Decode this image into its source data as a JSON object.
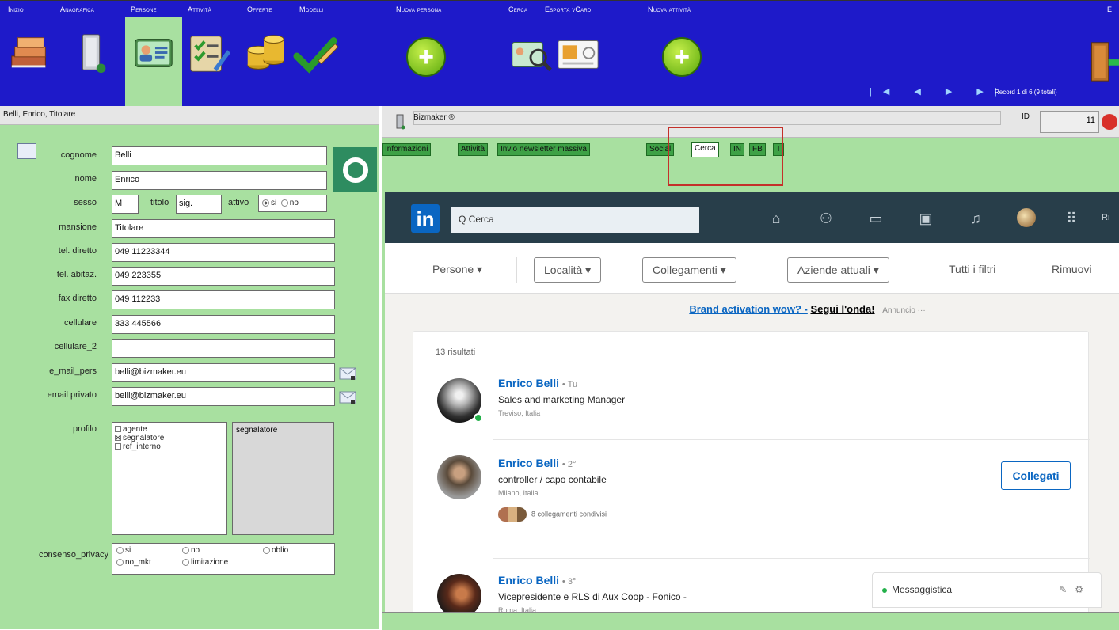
{
  "toolbar": {
    "menu": [
      {
        "label": "Inizio"
      },
      {
        "label": "Anagrafica"
      },
      {
        "label": "Persone"
      },
      {
        "label": "Attività"
      },
      {
        "label": "Offerte"
      },
      {
        "label": "Modelli"
      },
      {
        "label": "Nuova persona"
      },
      {
        "label": "Cerca"
      },
      {
        "label": "Esporta vCard"
      },
      {
        "label": "Nuova attività"
      },
      {
        "label": "E"
      }
    ],
    "plus_symbol": "+",
    "nav_arrows": "|◀ ◀ ▶ ▶|",
    "record_info": "Record 1 di 6 (9 totali)"
  },
  "left": {
    "header": "Belli, Enrico, Titolare",
    "fields": {
      "cognome": {
        "label": "cognome",
        "value": "Belli"
      },
      "nome": {
        "label": "nome",
        "value": "Enrico"
      },
      "sesso": {
        "label": "sesso",
        "value": "M"
      },
      "titolo": {
        "label": "titolo",
        "value": "sig."
      },
      "attivo": {
        "label": "attivo",
        "opt_si": "si",
        "opt_no": "no"
      },
      "mansione": {
        "label": "mansione",
        "value": "Titolare"
      },
      "tel_diretto": {
        "label": "tel. diretto",
        "value": "049 11223344"
      },
      "tel_abitaz": {
        "label": "tel. abitaz.",
        "value": "049 223355"
      },
      "fax_diretto": {
        "label": "fax diretto",
        "value": "049 112233"
      },
      "cellulare": {
        "label": "cellulare",
        "value": "333 445566"
      },
      "cellulare_2": {
        "label": "cellulare_2",
        "value": ""
      },
      "e_mail_pers": {
        "label": "e_mail_pers",
        "value": "belli@bizmaker.eu"
      },
      "email_privato": {
        "label": "email privato",
        "value": "belli@bizmaker.eu"
      },
      "profilo": {
        "label": "profilo",
        "options": [
          "agente",
          "segnalatore",
          "ref_interno"
        ],
        "selected_display": "segnalatore"
      },
      "consenso_privacy": {
        "label": "consenso_privacy",
        "options": [
          "si",
          "no",
          "oblio",
          "no_mkt",
          "limitazione"
        ]
      }
    }
  },
  "right": {
    "app_title": "Bizmaker ®",
    "id_label": "ID",
    "id_value": "11",
    "tabs": [
      {
        "label": "Informazioni"
      },
      {
        "label": "Attività"
      },
      {
        "label": "Invio newsletter massiva"
      },
      {
        "label": "Social"
      },
      {
        "label": "Cerca"
      },
      {
        "label": "IN"
      },
      {
        "label": "FB"
      },
      {
        "label": "T"
      }
    ]
  },
  "linkedin": {
    "logo": "in",
    "search_placeholder": "Q Cerca",
    "nav_icons": [
      "home-icon",
      "network-icon",
      "jobs-icon",
      "messaging-icon",
      "notifications-icon",
      "grid-icon"
    ],
    "more_label": "Ri",
    "filters": {
      "persone": "Persone ▾",
      "localita": "Località ▾",
      "collegamenti": "Collegamenti ▾",
      "aziende": "Aziende attuali ▾",
      "tutti": "Tutti i filtri",
      "rimuovi": "Rimuovi"
    },
    "ad": {
      "link": "Brand activation wow? -",
      "link2": "Segui l'onda!",
      "tag": "Annuncio ···"
    },
    "results_count": "13 risultati",
    "results": [
      {
        "name": "Enrico Belli",
        "degree": "• Tu",
        "title": "Sales and marketing Manager",
        "location": "Treviso, Italia"
      },
      {
        "name": "Enrico Belli",
        "degree": "• 2°",
        "title": "controller / capo contabile",
        "location": "Milano, Italia",
        "shared": "8 collegamenti condivisi",
        "action": "Collegati"
      },
      {
        "name": "Enrico Belli",
        "degree": "• 3°",
        "title": "Vicepresidente e RLS di Aux Coop - Fonico -",
        "location": "Roma, Italia"
      }
    ],
    "messaging": "Messaggistica"
  }
}
